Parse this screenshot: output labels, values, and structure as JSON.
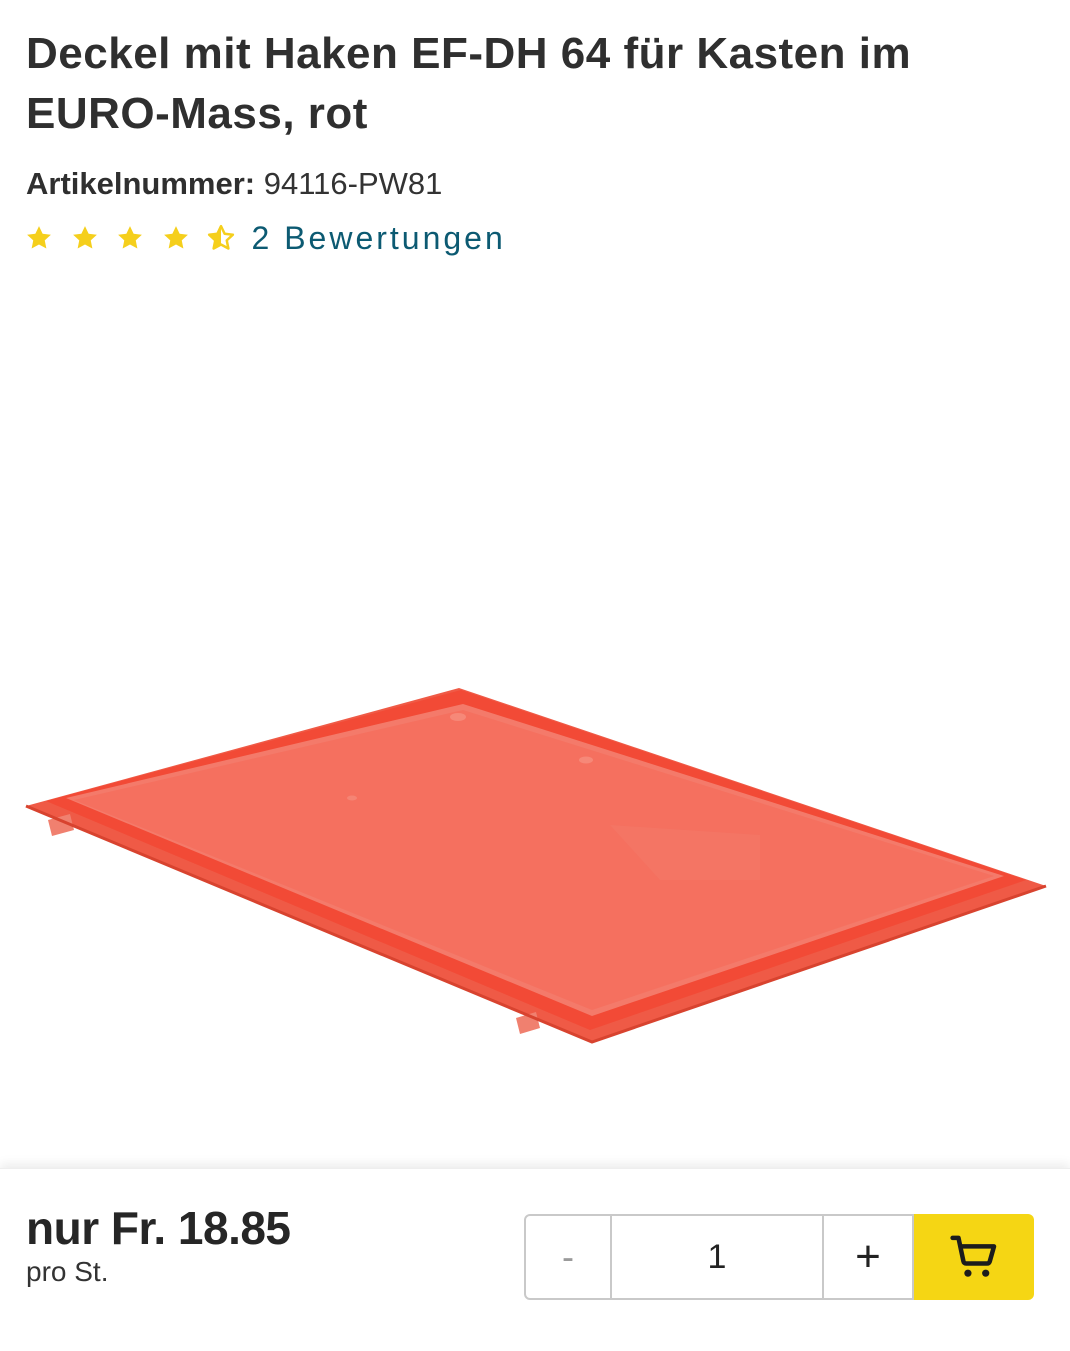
{
  "product": {
    "title": "Deckel mit Haken EF-DH 64 für Kasten im EURO-Mass, rot",
    "article_label": "Artikelnummer:",
    "article_number": "94116-PW81",
    "rating": {
      "value": 4.5,
      "max": 5,
      "reviews_text": "2 Bewertungen"
    },
    "image_icon": "red-lid-tray-icon"
  },
  "purchase": {
    "price": "nur Fr. 18.85",
    "unit": "pro St.",
    "minus_label": "-",
    "quantity": "1",
    "plus_label": "+",
    "cart_icon": "shopping-cart-icon"
  },
  "colors": {
    "star": "#f5cf1c",
    "link": "#0c5a72",
    "cart_button": "#f5d614",
    "lid": "#f26450"
  }
}
